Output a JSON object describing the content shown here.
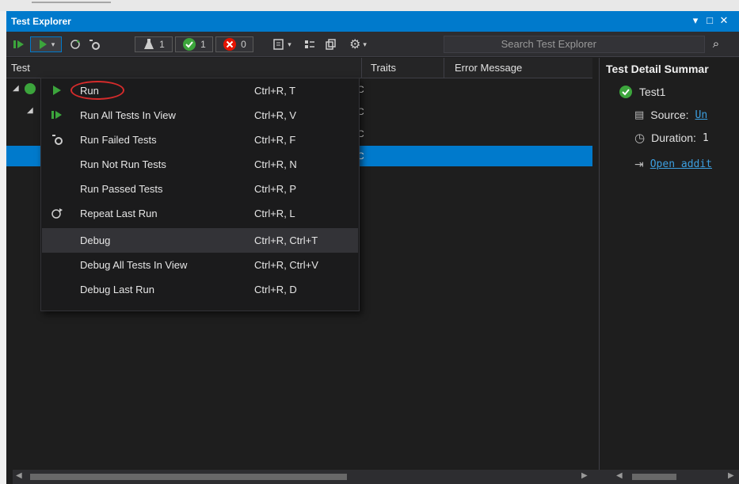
{
  "window": {
    "title": "Test Explorer",
    "pin_icon": "pin-dropdown-icon",
    "maximize_icon": "maximize-icon",
    "close_icon": "close-icon"
  },
  "toolbar": {
    "flask_count": "1",
    "passed_count": "1",
    "failed_count": "0",
    "search_placeholder": "Search Test Explorer"
  },
  "list": {
    "columns": [
      "Test",
      "Traits",
      "Error Message"
    ],
    "trait_values": [
      "C",
      "C",
      "C",
      "C"
    ]
  },
  "menu": {
    "items": [
      {
        "label": "Run",
        "shortcut": "Ctrl+R, T",
        "icon": "run-play-icon"
      },
      {
        "label": "Run All Tests In View",
        "shortcut": "Ctrl+R, V",
        "icon": "run-all-icon"
      },
      {
        "label": "Run Failed Tests",
        "shortcut": "Ctrl+R, F",
        "icon": "run-failed-icon"
      },
      {
        "label": "Run Not Run Tests",
        "shortcut": "Ctrl+R, N",
        "icon": ""
      },
      {
        "label": "Run Passed Tests",
        "shortcut": "Ctrl+R, P",
        "icon": ""
      },
      {
        "label": "Repeat Last Run",
        "shortcut": "Ctrl+R, L",
        "icon": "repeat-icon"
      },
      {
        "label": "Debug",
        "shortcut": "Ctrl+R, Ctrl+T",
        "icon": ""
      },
      {
        "label": "Debug All Tests In View",
        "shortcut": "Ctrl+R, Ctrl+V",
        "icon": ""
      },
      {
        "label": "Debug Last Run",
        "shortcut": "Ctrl+R, D",
        "icon": ""
      }
    ]
  },
  "detail": {
    "heading": "Test Detail Summar",
    "test_name": "Test1",
    "source_label": "Source:",
    "source_value": "Un",
    "duration_label": "Duration:",
    "duration_value": "1",
    "open_link": "Open addit"
  },
  "colors": {
    "accent": "#007acc",
    "pass": "#3ca53c",
    "fail": "#e51400",
    "highlight_circle": "#d52b2b"
  }
}
